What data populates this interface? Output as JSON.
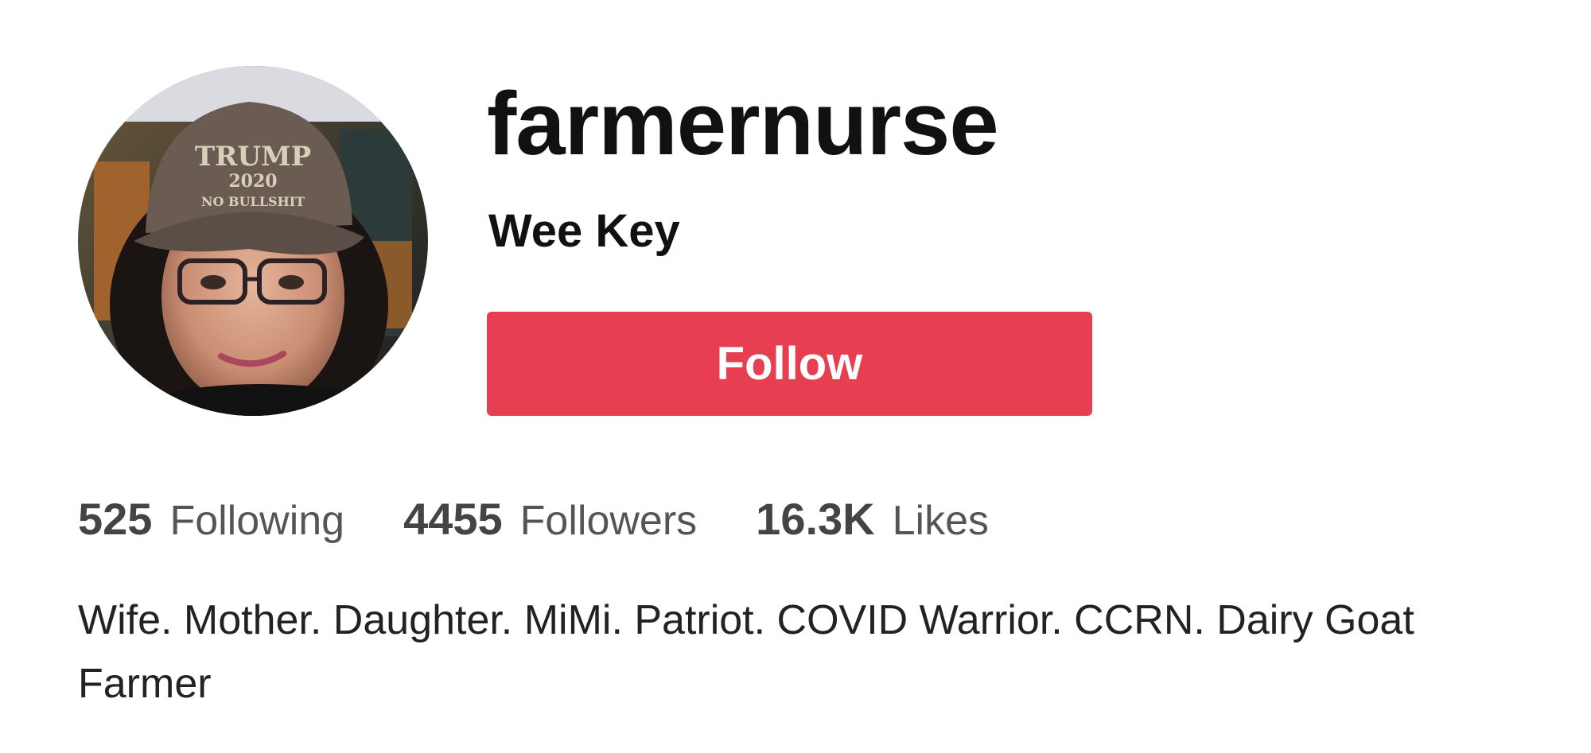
{
  "profile": {
    "username": "farmernurse",
    "nickname": "Wee Key",
    "avatar": {
      "icon": "profile-photo",
      "hat_text": [
        "TRUMP",
        "2020",
        "NO BULLSHIT"
      ]
    },
    "follow_label": "Follow",
    "stats": [
      {
        "number": "525",
        "label": "Following"
      },
      {
        "number": "4455",
        "label": "Followers"
      },
      {
        "number": "16.3K",
        "label": "Likes"
      }
    ],
    "bio": "Wife. Mother. Daughter. MiMi. Patriot. COVID Warrior. CCRN. Dairy Goat Farmer"
  },
  "colors": {
    "accent": "#e83e51",
    "text_primary": "#111111",
    "text_secondary": "#555555"
  }
}
